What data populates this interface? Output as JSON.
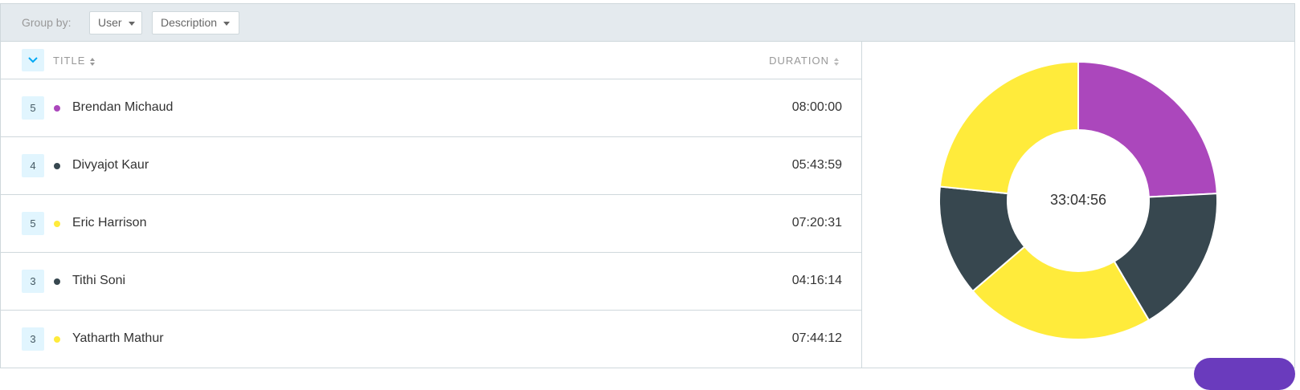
{
  "group_by": {
    "label": "Group by:",
    "primary": "User",
    "secondary": "Description"
  },
  "list_header": {
    "title": "TITLE",
    "duration": "DURATION"
  },
  "rows": [
    {
      "count": "5",
      "name": "Brendan Michaud",
      "duration": "08:00:00",
      "color": "#ab47bc"
    },
    {
      "count": "4",
      "name": "Divyajot Kaur",
      "duration": "05:43:59",
      "color": "#37474f"
    },
    {
      "count": "5",
      "name": "Eric Harrison",
      "duration": "07:20:31",
      "color": "#ffeb3b"
    },
    {
      "count": "3",
      "name": "Tithi Soni",
      "duration": "04:16:14",
      "color": "#37474f"
    },
    {
      "count": "3",
      "name": "Yatharth Mathur",
      "duration": "07:44:12",
      "color": "#ffeb3b"
    }
  ],
  "chart_data": {
    "type": "pie",
    "center_label": "33:04:56",
    "categories": [
      "Brendan Michaud",
      "Divyajot Kaur",
      "Eric Harrison",
      "Tithi Soni",
      "Yatharth Mathur"
    ],
    "values": [
      28800,
      20639,
      26431,
      15374,
      27852
    ],
    "colors": [
      "#ab47bc",
      "#37474f",
      "#ffeb3b",
      "#37474f",
      "#ffeb3b"
    ]
  },
  "colors": {
    "group_bar": "#e4eaee",
    "badge": "#e1f5fe",
    "border": "#cfd8dc",
    "fab": "#6a3bbd"
  }
}
